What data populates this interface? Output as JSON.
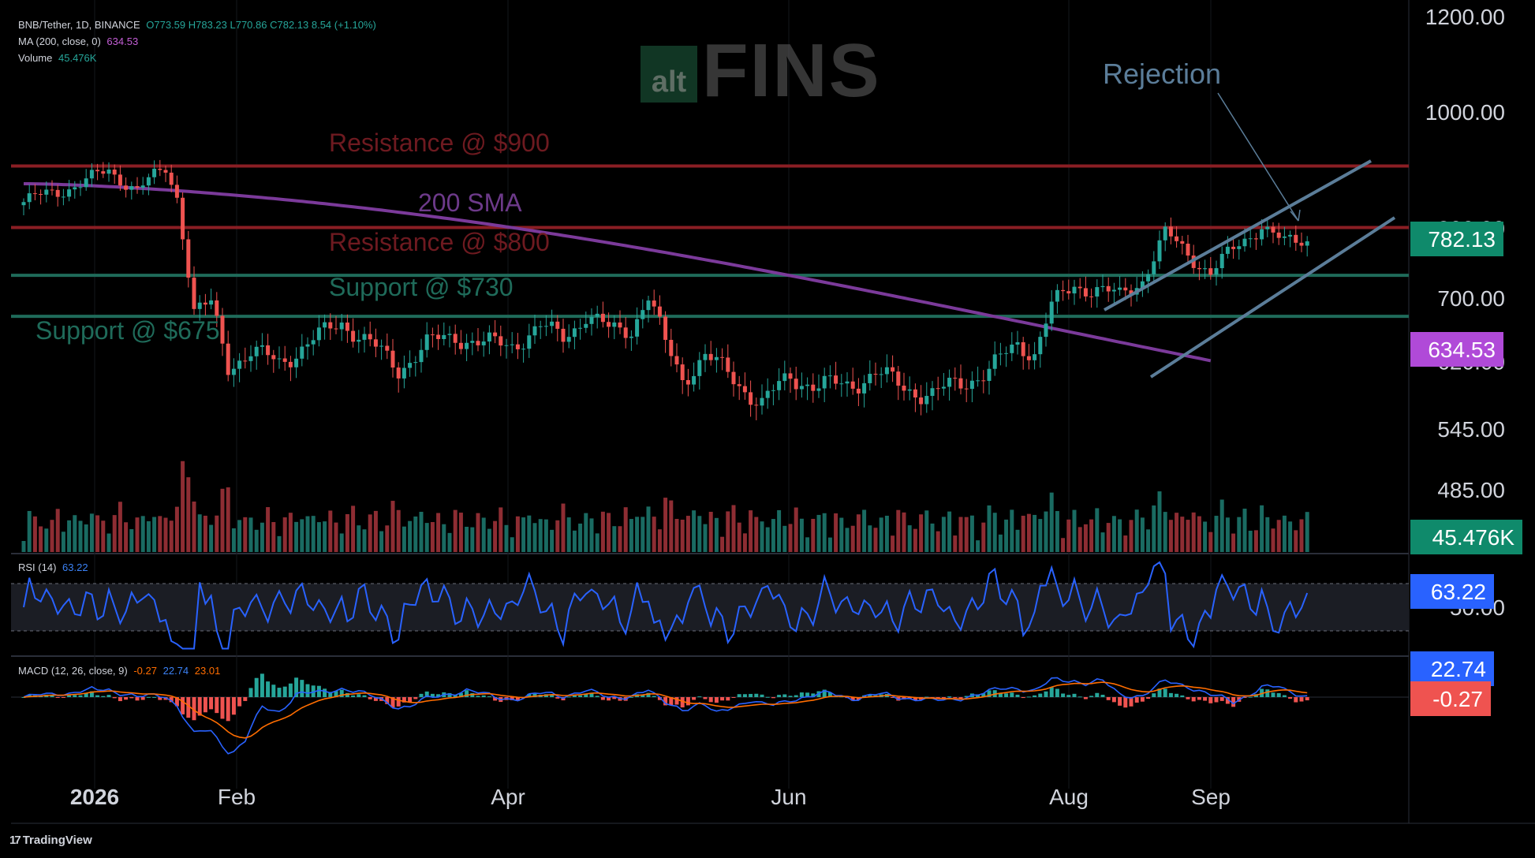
{
  "legend": {
    "symbol": "BNB/Tether, 1D, BINANCE",
    "ohlc": "O773.59  H783.23  L770.86  C782.13  8.54 (+1.10%)",
    "ma_label": "MA (200, close, 0)",
    "ma_value": "634.53",
    "volume_label": "Volume",
    "volume_value": "45.476K"
  },
  "rsi_legend": {
    "label": "RSI (14)",
    "value": "63.22"
  },
  "macd_legend": {
    "label": "MACD (12, 26, close, 9)",
    "macd": "-0.27",
    "signal": "22.74",
    "hist": "23.01"
  },
  "watermark": {
    "alt": "alt",
    "fins": "FINS"
  },
  "branding": "TradingView",
  "colors": {
    "up": "#26a69a",
    "down": "#ef5350",
    "sma": "#7b3a9a",
    "resistance": "#8a1e24",
    "support": "#1f6b5a",
    "channel": "#5b7d99",
    "rsi": "#2962ff",
    "macd": "#2962ff",
    "signal": "#ff6d00"
  },
  "chart_data": {
    "type": "candlestick",
    "pair": "BNB/Tether",
    "timeframe": "1D",
    "exchange": "BINANCE",
    "price_axis": {
      "scale": "log",
      "ticks": [
        "1200.00",
        "1000.00",
        "800.00",
        "700.00",
        "620.00",
        "545.00",
        "485.00"
      ]
    },
    "time_axis": [
      "2026",
      "Feb",
      "Apr",
      "Jun",
      "Aug",
      "Sep"
    ],
    "last_price": "782.13",
    "sma_value": "634.53",
    "volume_value": "45.476K",
    "rsi_value": "63.22",
    "rsi_axis": "50.00",
    "macd_values": {
      "signal": "22.74",
      "macd": "-0.27"
    },
    "levels": [
      {
        "label": "Resistance @ $900",
        "price": 900,
        "kind": "resistance"
      },
      {
        "label": "Resistance @ $800",
        "price": 800,
        "kind": "resistance"
      },
      {
        "label": "Support @ $730",
        "price": 730,
        "kind": "support"
      },
      {
        "label": "Support @ $675",
        "price": 675,
        "kind": "support"
      }
    ],
    "annotations": [
      "200 SMA",
      "Rejection"
    ],
    "price_path": [
      [
        0,
        860,
        840
      ],
      [
        5,
        845,
        855
      ],
      [
        10,
        872,
        870
      ],
      [
        15,
        895,
        892
      ],
      [
        20,
        885,
        860
      ],
      [
        25,
        895,
        895
      ],
      [
        27,
        884,
        850
      ],
      [
        30,
        830,
        680
      ],
      [
        33,
        678,
        690
      ],
      [
        36,
        640,
        615
      ],
      [
        40,
        625,
        630
      ],
      [
        45,
        632,
        618
      ],
      [
        50,
        615,
        640
      ],
      [
        56,
        650,
        668
      ],
      [
        61,
        668,
        640
      ],
      [
        66,
        640,
        610
      ],
      [
        71,
        612,
        640
      ],
      [
        76,
        642,
        650
      ],
      [
        81,
        650,
        640
      ],
      [
        86,
        632,
        640
      ],
      [
        91,
        642,
        660
      ],
      [
        95,
        662,
        650
      ],
      [
        99,
        648,
        675
      ],
      [
        103,
        672,
        658
      ],
      [
        107,
        655,
        660
      ],
      [
        110,
        665,
        700
      ],
      [
        113,
        700,
        640
      ],
      [
        116,
        632,
        600
      ],
      [
        120,
        605,
        625
      ],
      [
        125,
        622,
        600
      ],
      [
        130,
        592,
        570
      ],
      [
        135,
        572,
        602
      ],
      [
        140,
        600,
        590
      ],
      [
        145,
        588,
        592
      ],
      [
        150,
        595,
        605
      ],
      [
        155,
        600,
        590
      ],
      [
        160,
        585,
        580
      ],
      [
        165,
        585,
        595
      ],
      [
        170,
        598,
        608
      ],
      [
        175,
        605,
        640
      ],
      [
        178,
        648,
        630
      ],
      [
        181,
        640,
        688
      ],
      [
        185,
        690,
        715
      ],
      [
        189,
        715,
        712
      ],
      [
        193,
        710,
        700
      ],
      [
        197,
        702,
        725
      ],
      [
        201,
        722,
        790
      ],
      [
        205,
        785,
        760
      ],
      [
        209,
        755,
        735
      ],
      [
        213,
        735,
        765
      ],
      [
        218,
        768,
        805
      ],
      [
        222,
        800,
        775
      ],
      [
        226,
        775,
        782
      ]
    ]
  }
}
